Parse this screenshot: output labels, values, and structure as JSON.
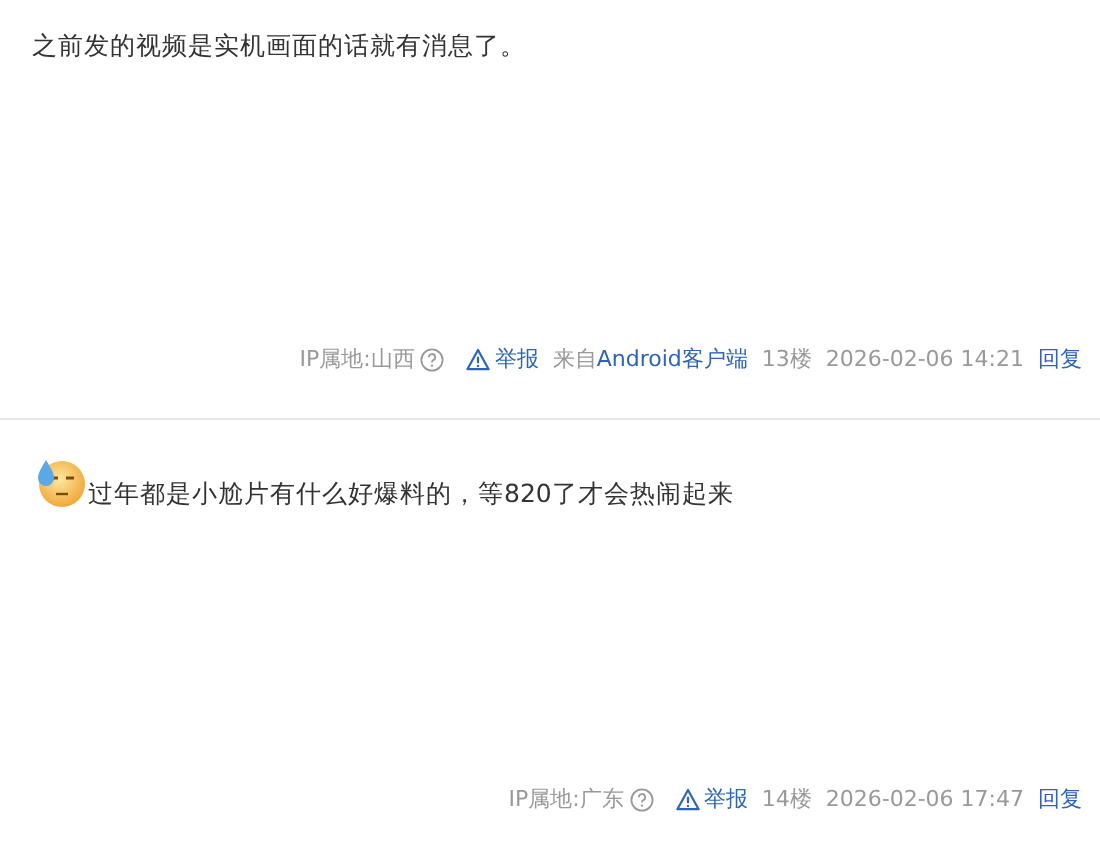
{
  "posts": [
    {
      "emoji": false,
      "text": "之前发的视频是实机画面的话就有消息了。",
      "ip": "IP属地:山西",
      "report": "举报",
      "source": {
        "prefix": "来自",
        "link": "Android客户端"
      },
      "floor": "13楼",
      "time": "2026-02-06 14:21",
      "reply": "回复"
    },
    {
      "emoji": true,
      "text": "过年都是小尬片有什么好爆料的，等820了才会热闹起来",
      "ip": "IP属地:广东",
      "report": "举报",
      "floor": "14楼",
      "time": "2026-02-06 17:47",
      "reply": "回复"
    }
  ]
}
